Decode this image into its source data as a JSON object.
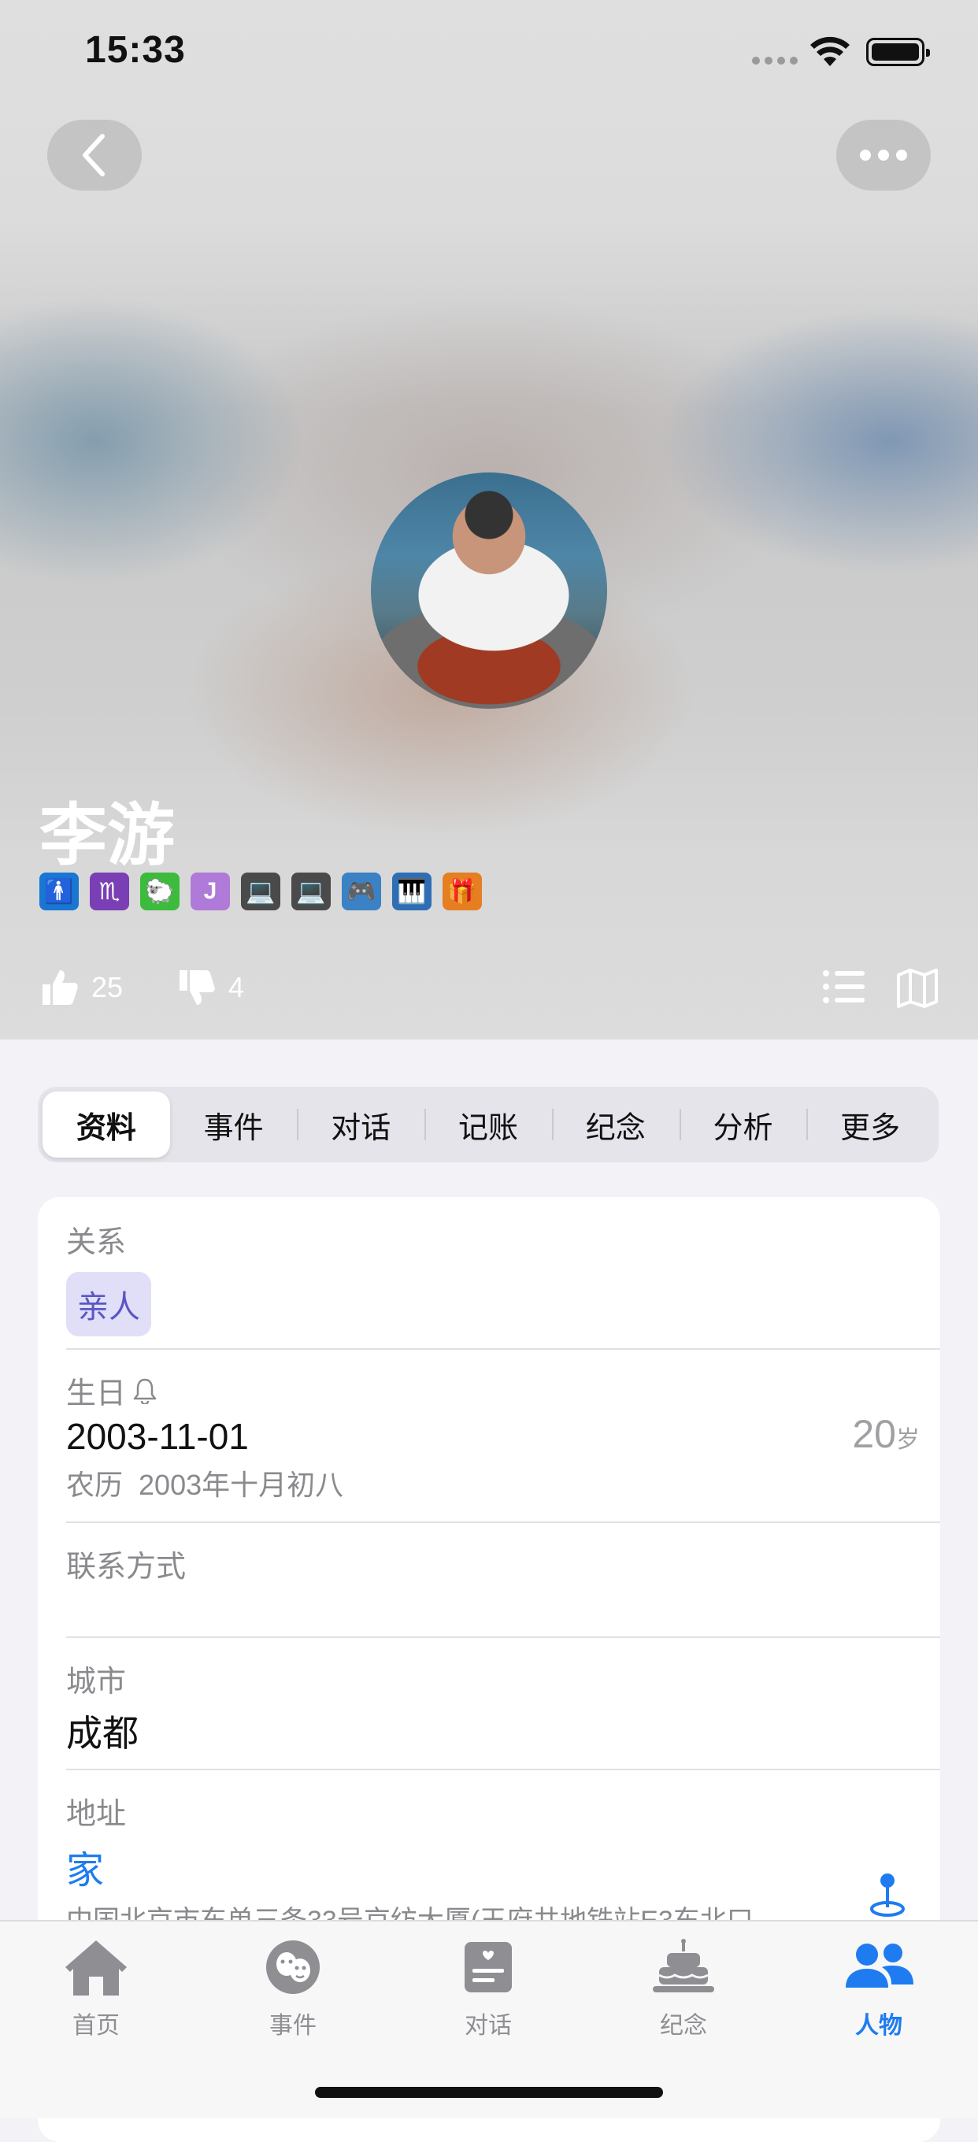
{
  "status": {
    "time": "15:33"
  },
  "profile": {
    "name": "李游",
    "tags": [
      {
        "icon": "accessibility-icon",
        "glyph": "🚹",
        "color": "#1976d2"
      },
      {
        "icon": "scorpio-icon",
        "glyph": "♏",
        "color": "#7b3fb5"
      },
      {
        "icon": "sheep-icon",
        "glyph": "🐑",
        "color": "#3dbb3d"
      },
      {
        "icon": "letter-j-icon",
        "glyph": "J",
        "color": "#b07ad8"
      },
      {
        "icon": "laptop-icon",
        "glyph": "💻",
        "color": "#4a4a4a"
      },
      {
        "icon": "laptop-icon",
        "glyph": "💻",
        "color": "#4a4a4a"
      },
      {
        "icon": "gamepad-icon",
        "glyph": "🎮",
        "color": "#3b82c4"
      },
      {
        "icon": "piano-icon",
        "glyph": "🎹",
        "color": "#2f6eb5"
      },
      {
        "icon": "gift-icon",
        "glyph": "🎁",
        "color": "#e67e22"
      }
    ],
    "likes": "25",
    "dislikes": "4"
  },
  "segments": [
    "资料",
    "事件",
    "对话",
    "记账",
    "纪念",
    "分析",
    "更多"
  ],
  "info": {
    "relation_label": "关系",
    "relation_value": "亲人",
    "birthday_label": "生日",
    "birthday_value": "2003-11-01",
    "age_number": "20",
    "age_unit": "岁",
    "lunar_prefix": "农历",
    "lunar_value": "2003年十月初八",
    "contact_label": "联系方式",
    "city_label": "城市",
    "city_value": "成都",
    "address_label": "地址",
    "address_name": "家",
    "address_detail": "中国北京市东单三条33号京纺大厦(王府井地铁站E3东北口"
  },
  "tabs": [
    {
      "label": "首页",
      "icon": "home-icon"
    },
    {
      "label": "事件",
      "icon": "masks-icon"
    },
    {
      "label": "对话",
      "icon": "chat-card-icon"
    },
    {
      "label": "纪念",
      "icon": "cake-icon"
    },
    {
      "label": "人物",
      "icon": "people-icon"
    }
  ],
  "colors": {
    "accent": "#1e7cf0",
    "chip_bg": "#e0dff7",
    "chip_text": "#5b56c4"
  }
}
